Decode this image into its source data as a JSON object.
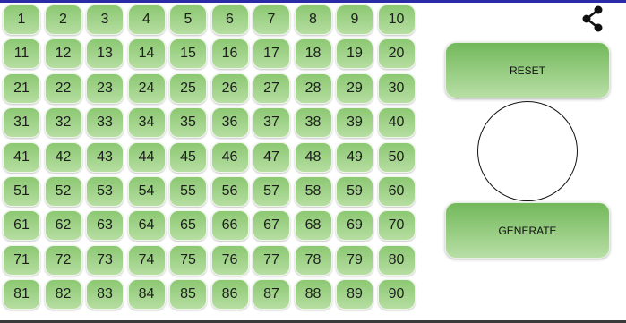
{
  "numbers": [
    "1",
    "2",
    "3",
    "4",
    "5",
    "6",
    "7",
    "8",
    "9",
    "10",
    "11",
    "12",
    "13",
    "14",
    "15",
    "16",
    "17",
    "18",
    "19",
    "20",
    "21",
    "22",
    "23",
    "24",
    "25",
    "26",
    "27",
    "28",
    "29",
    "30",
    "31",
    "32",
    "33",
    "34",
    "35",
    "36",
    "37",
    "38",
    "39",
    "40",
    "41",
    "42",
    "43",
    "44",
    "45",
    "46",
    "47",
    "48",
    "49",
    "50",
    "51",
    "52",
    "53",
    "54",
    "55",
    "56",
    "57",
    "58",
    "59",
    "60",
    "61",
    "62",
    "63",
    "64",
    "65",
    "66",
    "67",
    "68",
    "69",
    "70",
    "71",
    "72",
    "73",
    "74",
    "75",
    "76",
    "77",
    "78",
    "79",
    "80",
    "81",
    "82",
    "83",
    "84",
    "85",
    "86",
    "87",
    "88",
    "89",
    "90"
  ],
  "controls": {
    "reset_label": "RESET",
    "generate_label": "GENERATE",
    "current_number": ""
  },
  "icons": {
    "share": "share-icon"
  },
  "colors": {
    "button_green_top": "#8cc872",
    "button_green_bottom": "#b6dea2",
    "accent_bar": "#2b2ba8"
  }
}
